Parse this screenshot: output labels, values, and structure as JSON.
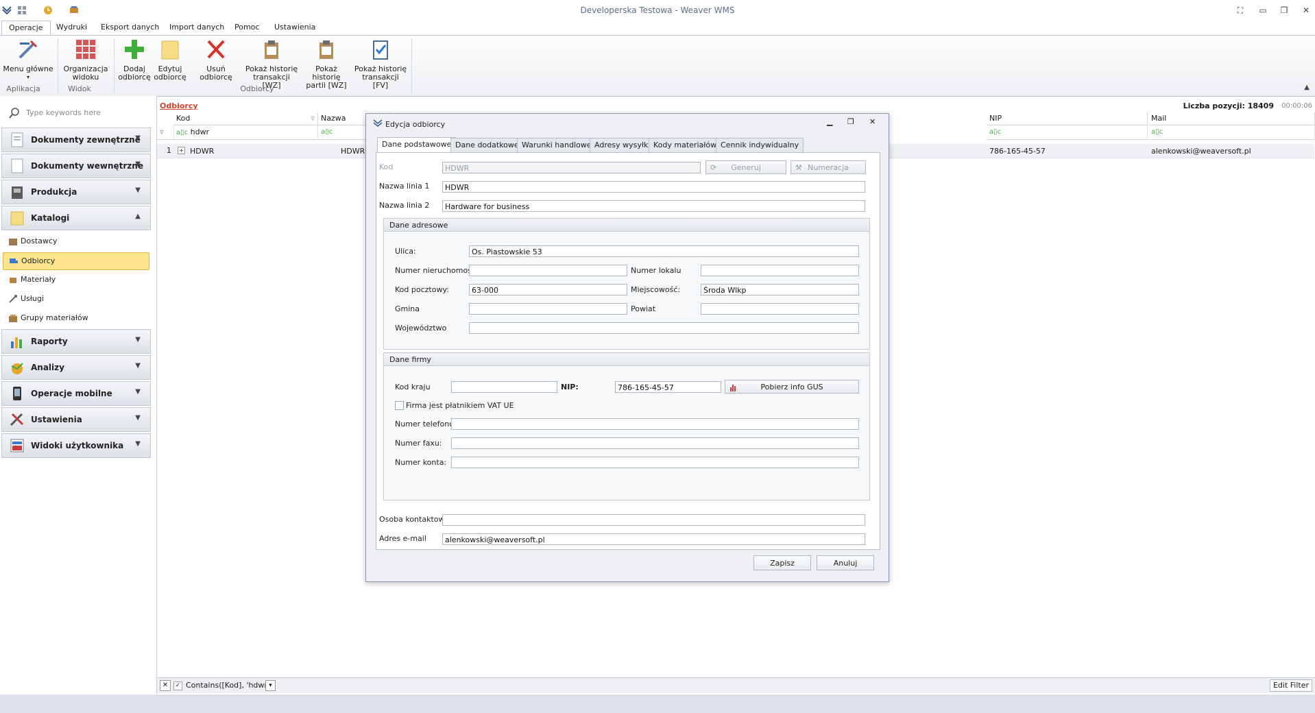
{
  "window": {
    "title": "Developerska Testowa - Weaver WMS"
  },
  "ribbon": {
    "tabs": [
      "Operacje",
      "Wydruki",
      "Eksport danych",
      "Import danych",
      "Pomoc",
      "Ustawienia"
    ],
    "buttons": {
      "menu": [
        "Menu główne",
        ""
      ],
      "org": [
        "Organizacja",
        "widoku"
      ],
      "add": [
        "Dodaj",
        "odbiorcę"
      ],
      "edit": [
        "Edytuj",
        "odbiorcę"
      ],
      "del": [
        "Usuń odbiorcę",
        ""
      ],
      "hist_wz": [
        "Pokaż historię",
        "transakcji [WZ]"
      ],
      "hist_partii": [
        "Pokaż historię",
        "partii [WZ]"
      ],
      "hist_fv": [
        "Pokaż historię",
        "transakcji [FV]"
      ]
    },
    "groups": {
      "app": "Aplikacja",
      "view": "Widok",
      "recv": "Odbiorcy"
    }
  },
  "sidebar": {
    "search_placeholder": "Type keywords here",
    "groups": {
      "ext": "Dokumenty zewnętrzne",
      "int": "Dokumenty wewnętrzne",
      "prod": "Produkcja",
      "cat": "Katalogi",
      "rep": "Raporty",
      "ana": "Analizy",
      "mob": "Operacje mobilne",
      "set": "Ustawienia",
      "usr": "Widoki użytkownika"
    },
    "items": {
      "dost": "Dostawcy",
      "odb": "Odbiorcy",
      "mat": "Materiały",
      "usl": "Usługi",
      "grp": "Grupy materiałów"
    }
  },
  "grid": {
    "breadcrumb": "Odbiorcy",
    "count_label": "Liczba pozycji: 18409",
    "time": "00:00:06",
    "columns": {
      "kod": "Kod",
      "nazwa": "Nazwa",
      "nip": "NIP",
      "mail": "Mail"
    },
    "filter": {
      "kod": "hdwr"
    },
    "row": {
      "num": "1",
      "kod": "HDWR",
      "nazwa": "HDWR",
      "nip": "786-165-45-57",
      "mail": "alenkowski@weaversoft.pl"
    },
    "filter_expression": "Contains([Kod], 'hdwr')",
    "edit_filter": "Edit Filter"
  },
  "dialog": {
    "title": "Edycja odbiorcy",
    "tabs": [
      "Dane podstawowe",
      "Dane dodatkowe",
      "Warunki handlowe",
      "Adresy wysyłki",
      "Kody materiałów",
      "Cennik indywidualny"
    ],
    "kod_label": "Kod",
    "kod_value": "HDWR",
    "generate": "Generuj",
    "numbering": "Numeracja",
    "name1_label": "Nazwa linia 1",
    "name1": "HDWR",
    "name2_label": "Nazwa linia 2",
    "name2": "Hardware for business",
    "address": {
      "header": "Dane adresowe",
      "street_label": "Ulica:",
      "street": "Os. Piastowskie 53",
      "num_label": "Numer nieruchomości",
      "num": "",
      "local_label": "Numer lokalu",
      "local": "",
      "zip_label": "Kod pocztowy:",
      "zip": "63-000",
      "city_label": "Miejscowość:",
      "city": "Środa Wlkp",
      "gmina_label": "Gmina",
      "gmina": "",
      "powiat_label": "Powiat",
      "powiat": "",
      "woj_label": "Województwo",
      "woj": ""
    },
    "company": {
      "header": "Dane firmy",
      "country_label": "Kod kraju",
      "country": "",
      "nip_label": "NIP:",
      "nip": "786-165-45-57",
      "gus_button": "Pobierz info GUS",
      "vat_label": "Firma jest płatnikiem VAT UE",
      "phone_label": "Numer telefonu:",
      "phone": "",
      "fax_label": "Numer faxu:",
      "fax": "",
      "account_label": "Numer konta:",
      "account": ""
    },
    "contact_label": "Osoba kontaktowa",
    "contact": "",
    "email_label": "Adres e-mail",
    "email": "alenkowski@weaversoft.pl",
    "save": "Zapisz",
    "cancel": "Anuluj"
  }
}
